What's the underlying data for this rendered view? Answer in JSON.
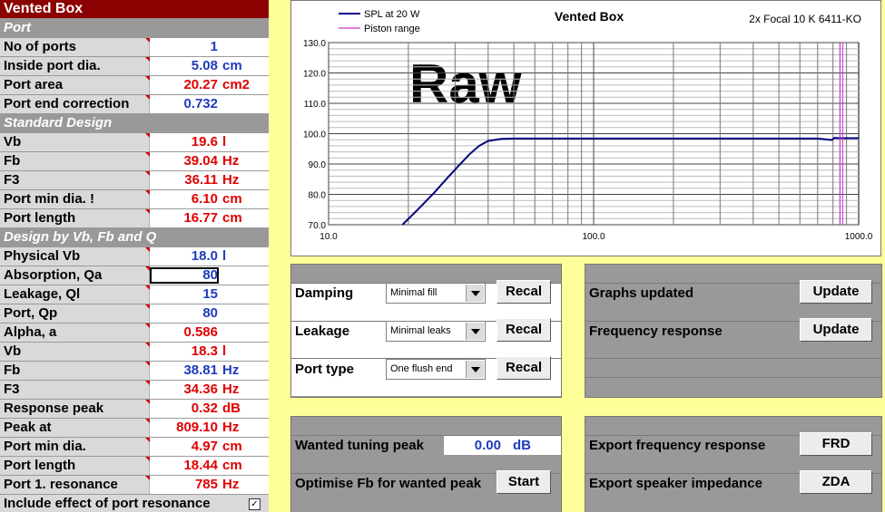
{
  "left": {
    "title": "Vented Box",
    "sections": {
      "port": "Port",
      "standard": "Standard Design",
      "design": "Design by Vb, Fb and Q"
    },
    "rows": {
      "ports": {
        "label": "No of ports",
        "value": "1",
        "unit": ""
      },
      "port_dia": {
        "label": "Inside port dia.",
        "value": "5.08",
        "unit": "cm"
      },
      "port_area": {
        "label": "Port area",
        "value": "20.27",
        "unit": "cm2"
      },
      "end_corr": {
        "label": "Port end correction",
        "value": "0.732",
        "unit": ""
      },
      "std_vb": {
        "label": "Vb",
        "value": "19.6",
        "unit": "l"
      },
      "std_fb": {
        "label": "Fb",
        "value": "39.04",
        "unit": "Hz"
      },
      "std_f3": {
        "label": "F3",
        "value": "36.11",
        "unit": "Hz"
      },
      "std_pmin": {
        "label": "Port min dia. !",
        "value": "6.10",
        "unit": "cm"
      },
      "std_plen": {
        "label": "Port length",
        "value": "16.77",
        "unit": "cm"
      },
      "phys_vb": {
        "label": "Physical Vb",
        "value": "18.0",
        "unit": "l"
      },
      "qa": {
        "label": "Absorption, Qa",
        "value": "80",
        "unit": ""
      },
      "ql": {
        "label": "Leakage, Ql",
        "value": "15",
        "unit": ""
      },
      "qp": {
        "label": "Port, Qp",
        "value": "80",
        "unit": ""
      },
      "alpha": {
        "label": "Alpha, a",
        "value": "0.586",
        "unit": ""
      },
      "d_vb": {
        "label": "Vb",
        "value": "18.3",
        "unit": "l"
      },
      "d_fb": {
        "label": "Fb",
        "value": "38.81",
        "unit": "Hz"
      },
      "d_f3": {
        "label": "F3",
        "value": "34.36",
        "unit": "Hz"
      },
      "peak": {
        "label": "Response peak",
        "value": "0.32",
        "unit": "dB"
      },
      "peak_at": {
        "label": "Peak at",
        "value": "809.10",
        "unit": "Hz"
      },
      "d_pmin": {
        "label": "Port min dia.",
        "value": "4.97",
        "unit": "cm"
      },
      "d_plen": {
        "label": "Port length",
        "value": "18.44",
        "unit": "cm"
      },
      "p1res": {
        "label": "Port 1. resonance",
        "value": "785",
        "unit": "Hz"
      }
    },
    "include_label": "Include effect of port resonance",
    "include_checked": "✓"
  },
  "chart_data": {
    "type": "line",
    "title": "Vented Box",
    "subtitle": "2x Focal 10 K 6411-KO",
    "watermark": "Raw",
    "x_scale": "log",
    "xlim": [
      10,
      1000
    ],
    "ylim": [
      70,
      130
    ],
    "x_ticks": [
      "10.0",
      "100.0",
      "1000.0"
    ],
    "y_ticks": [
      "70.0",
      "80.0",
      "90.0",
      "100.0",
      "110.0",
      "120.0",
      "130.0"
    ],
    "legend": "top-left",
    "series": [
      {
        "name": "SPL at 20 W",
        "color": "#000080",
        "x": [
          19,
          22,
          25,
          28,
          31,
          34,
          37,
          40,
          45,
          50,
          60,
          100,
          200,
          400,
          700,
          790,
          810,
          850,
          1000
        ],
        "y": [
          70,
          75.5,
          80.5,
          85.3,
          89.5,
          93.2,
          96,
          97.6,
          98.3,
          98.4,
          98.4,
          98.4,
          98.4,
          98.4,
          98.4,
          97.9,
          98.6,
          98.5,
          98.5
        ]
      },
      {
        "name": "Piston range",
        "color": "#cc33cc",
        "x": [
          850,
          850
        ],
        "y": [
          70,
          130
        ]
      }
    ],
    "grid": true
  },
  "controls": {
    "damping": {
      "label": "Damping",
      "value": "Minimal fill",
      "button": "Recal"
    },
    "leakage": {
      "label": "Leakage",
      "value": "Minimal leaks",
      "button": "Recal"
    },
    "port_type": {
      "label": "Port type",
      "value": "One flush end",
      "button": "Recal"
    },
    "graphs": {
      "label": "Graphs updated",
      "button": "Update"
    },
    "freq": {
      "label": "Frequency response",
      "button": "Update"
    },
    "tuning": {
      "label": "Wanted tuning peak",
      "value": "0.00",
      "unit": "dB"
    },
    "optimise": {
      "label": "Optimise Fb for wanted peak",
      "button": "Start"
    },
    "export_fr": {
      "label": "Export frequency response",
      "button": "FRD"
    },
    "export_imp": {
      "label": "Export speaker impedance",
      "button": "ZDA"
    }
  },
  "colors": {
    "title_bg": "#8b0000",
    "section_bg": "#999999",
    "sheet_bg": "#ffff99",
    "blue_value": "#1f3bbd",
    "red_value": "#e00000"
  }
}
